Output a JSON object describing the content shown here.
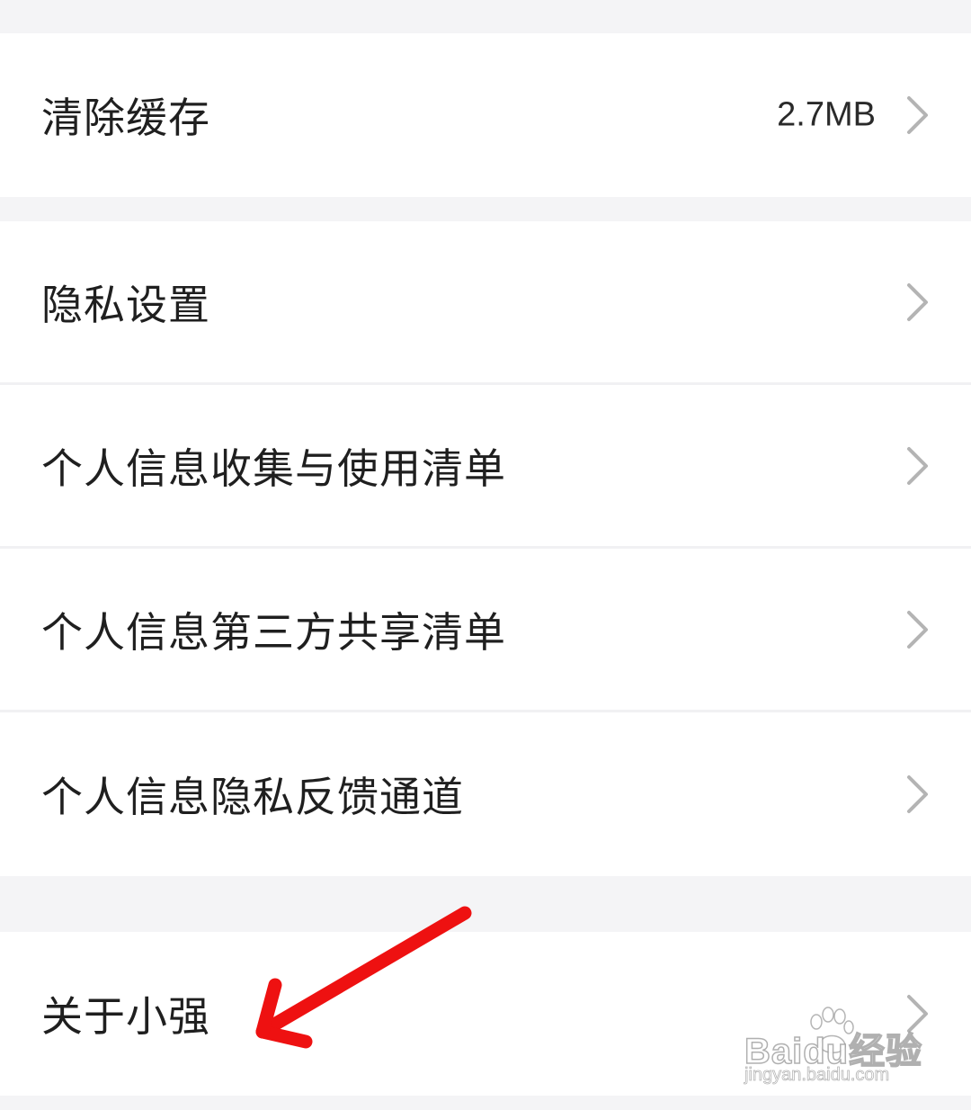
{
  "settings": {
    "cache_group": {
      "clear_cache": {
        "label": "清除缓存",
        "value": "2.7MB",
        "icon": "chevron-right-icon"
      }
    },
    "privacy_group": {
      "items": [
        {
          "label": "隐私设置",
          "icon": "chevron-right-icon"
        },
        {
          "label": "个人信息收集与使用清单",
          "icon": "chevron-right-icon"
        },
        {
          "label": "个人信息第三方共享清单",
          "icon": "chevron-right-icon"
        },
        {
          "label": "个人信息隐私反馈通道",
          "icon": "chevron-right-icon"
        }
      ]
    },
    "about_group": {
      "about": {
        "label": "关于小强",
        "icon": "chevron-right-icon"
      }
    }
  },
  "annotation": {
    "arrow_color": "#ee1111",
    "arrow_icon": "red-arrow-annotation"
  },
  "watermark": {
    "main_text": "Baidu经验",
    "sub_text": "jingyan.baidu.com"
  },
  "colors": {
    "background": "#f4f4f6",
    "row_background": "#ffffff",
    "text": "#1f1f1f",
    "chevron": "#b4b4b4"
  }
}
